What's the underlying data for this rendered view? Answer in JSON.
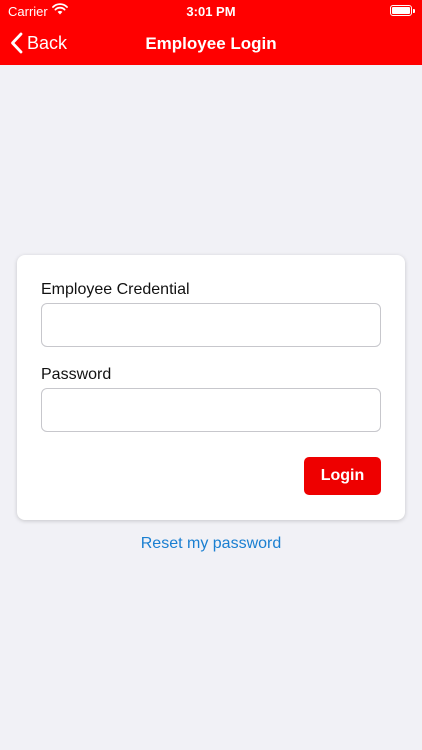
{
  "status_bar": {
    "carrier": "Carrier",
    "time": "3:01 PM"
  },
  "nav": {
    "back_label": "Back",
    "title": "Employee Login"
  },
  "form": {
    "credential_label": "Employee Credential",
    "credential_value": "",
    "password_label": "Password",
    "password_value": "",
    "login_label": "Login"
  },
  "reset_link": "Reset my password",
  "colors": {
    "brand_red": "#ff0000",
    "button_red": "#ee0000",
    "link_blue": "#1a7fd1",
    "background": "#f1f1f6"
  },
  "icons": {
    "back": "chevron-left-icon",
    "wifi": "wifi-icon",
    "battery": "battery-icon"
  }
}
